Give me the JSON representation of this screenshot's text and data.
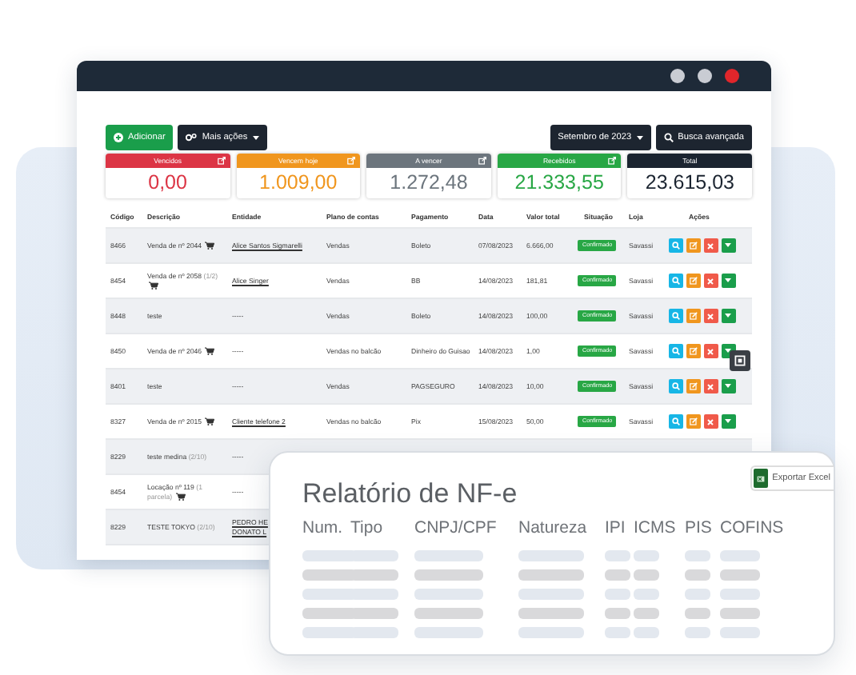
{
  "window": {
    "controls": [
      {
        "color": "#c9ccd3"
      },
      {
        "color": "#c9ccd3"
      },
      {
        "color": "#e0262b"
      }
    ]
  },
  "toolbar": {
    "left": [
      {
        "kind": "add",
        "label": "Adicionar"
      },
      {
        "kind": "menu",
        "label": "Mais ações"
      }
    ],
    "right": [
      {
        "kind": "dropdown",
        "label": "Setembro de 2023"
      },
      {
        "kind": "search",
        "label": "Busca avançada"
      }
    ]
  },
  "summary": [
    {
      "label": "Vencidos",
      "value": "0,00",
      "color": "#dc3545",
      "link": true
    },
    {
      "label": "Vencem hoje",
      "value": "1.009,00",
      "color": "#f0961e",
      "link": true
    },
    {
      "label": "A vencer",
      "value": "1.272,48",
      "color": "#6c757d",
      "link": true
    },
    {
      "label": "Recebidos",
      "value": "21.333,55",
      "color": "#28a745",
      "link": true
    },
    {
      "label": "Total",
      "value": "23.615,03",
      "color": "#1b2430",
      "link": false
    }
  ],
  "table": {
    "columns": [
      "Código",
      "Descrição",
      "Entidade",
      "Plano de contas",
      "Pagamento",
      "Data",
      "Valor total",
      "Situação",
      "Loja",
      "Ações"
    ],
    "rows": [
      {
        "code": "8466",
        "description": "Venda de nº 2044",
        "cart": true,
        "entity": "Alice Santos Sigmarelli",
        "entity_link": true,
        "account": "Vendas",
        "payment": "Boleto",
        "date": "07/08/2023",
        "total": "6.666,00",
        "status": "Confirmado",
        "store": "Savassi",
        "actions": true
      },
      {
        "code": "8454",
        "description": "Venda de nº 2058",
        "note": "(1/2)",
        "cart": true,
        "entity": "Alice Singer",
        "entity_link": true,
        "account": "Vendas",
        "payment": "BB",
        "date": "14/08/2023",
        "total": "181,81",
        "status": "Confirmado",
        "store": "Savassi",
        "actions": true
      },
      {
        "code": "8448",
        "description": "teste",
        "cart": false,
        "entity": "-----",
        "entity_link": false,
        "account": "Vendas",
        "payment": "Boleto",
        "date": "14/08/2023",
        "total": "100,00",
        "status": "Confirmado",
        "store": "Savassi",
        "actions": true
      },
      {
        "code": "8450",
        "description": "Venda de nº 2046",
        "cart": true,
        "entity": "-----",
        "entity_link": false,
        "account": "Vendas no balcão",
        "payment": "Dinheiro do Guisao",
        "date": "14/08/2023",
        "total": "1,00",
        "status": "Confirmado",
        "store": "Savassi",
        "actions": true
      },
      {
        "code": "8401",
        "description": "teste",
        "cart": false,
        "entity": "-----",
        "entity_link": false,
        "account": "Vendas",
        "payment": "PAGSEGURO",
        "date": "14/08/2023",
        "total": "10,00",
        "status": "Confirmado",
        "store": "Savassi",
        "actions": true
      },
      {
        "code": "8327",
        "description": "Venda de nº 2015",
        "cart": true,
        "entity": "Cliente telefone 2",
        "entity_link": true,
        "account": "Vendas no balcão",
        "payment": "Pix",
        "date": "15/08/2023",
        "total": "50,00",
        "status": "Confirmado",
        "store": "Savassi",
        "actions": true
      },
      {
        "code": "8229",
        "description": "teste medina",
        "note": "(2/10)",
        "cart": false,
        "entity": "-----",
        "entity_link": false,
        "actions": false
      },
      {
        "code": "8454",
        "description": "Locação nº 119",
        "note": "(1 parcela)",
        "cart": true,
        "entity": "-----",
        "entity_link": false,
        "actions": false
      },
      {
        "code": "8229",
        "description": "TESTE TOKYO",
        "note": "(2/10)",
        "cart": false,
        "entity": "PEDRO HE\nDONATO L",
        "entity_link": true,
        "actions": false
      }
    ]
  },
  "report": {
    "title": "Relatório de NF-e",
    "export_label": "Exportar Excel",
    "columns": [
      "Num.",
      "Tipo",
      "CNPJ/CPF",
      "Natureza",
      "IPI",
      "ICMS",
      "PIS",
      "COFINS"
    ],
    "rows": [
      {
        "kind": "light"
      },
      {
        "kind": "dark"
      },
      {
        "kind": "light"
      },
      {
        "kind": "dark"
      },
      {
        "kind": "light"
      }
    ]
  }
}
